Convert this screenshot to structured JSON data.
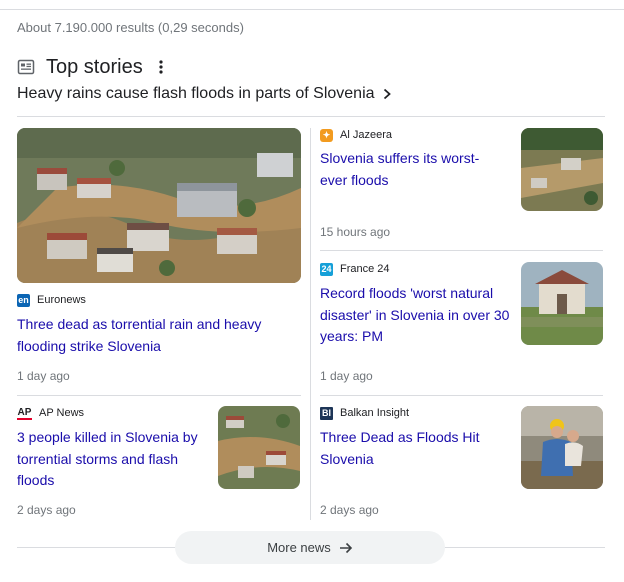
{
  "result_stats": "About 7.190.000 results (0,29 seconds)",
  "section": {
    "title": "Top stories",
    "headline": "Heavy rains cause flash floods in parts of Slovenia"
  },
  "stories": [
    {
      "source": "Euronews",
      "source_logo": "euronews-logo",
      "title": "Three dead as torrential rain and heavy flooding strike Slovenia",
      "time": "1 day ago",
      "image": "flooded-town-aerial-photo"
    },
    {
      "source": "Al Jazeera",
      "source_logo": "al-jazeera-logo",
      "title": "Slovenia suffers its worst-ever floods",
      "time": "15 hours ago",
      "image": "flooded-streets-aerial-photo"
    },
    {
      "source": "France 24",
      "source_logo": "france24-logo",
      "title": "Record floods 'worst natural disaster' in Slovenia in over 30 years: PM",
      "time": "1 day ago",
      "image": "flooded-house-photo"
    },
    {
      "source": "AP News",
      "source_logo": "ap-logo",
      "title": "3 people killed in Slovenia by torrential storms and flash floods",
      "time": "2 days ago",
      "image": "flooded-village-aerial-photo"
    },
    {
      "source": "Balkan Insight",
      "source_logo": "balkan-insight-logo",
      "title": "Three Dead as Floods Hit Slovenia",
      "time": "2 days ago",
      "image": "rescuer-carrying-child-photo"
    }
  ],
  "more_news_label": "More news",
  "colors": {
    "link": "#1a0dab",
    "meta": "#70757a",
    "divider": "#dadce0",
    "button_bg": "#f1f3f4"
  }
}
